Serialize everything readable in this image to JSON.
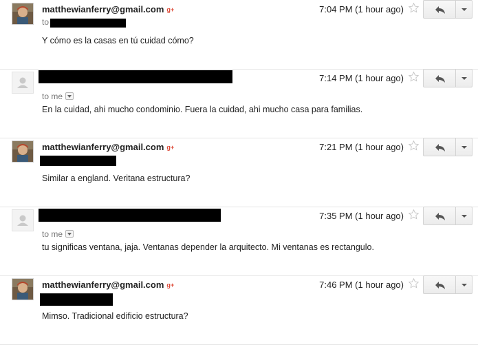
{
  "messages": [
    {
      "sender": "matthewianferry@gmail.com",
      "avatar": "profile-photo",
      "recipient_prefix": "to",
      "time": "7:04 PM (1 hour ago)",
      "body": "Y cómo es la casas en tú cuidad cómo?"
    },
    {
      "sender": "",
      "avatar": "default-person-icon",
      "recipient_prefix": "to me",
      "time": "7:14 PM (1 hour ago)",
      "body": "En la cuidad, ahi mucho condominio. Fuera la cuidad, ahi mucho casa para familias."
    },
    {
      "sender": "matthewianferry@gmail.com",
      "avatar": "profile-photo",
      "recipient_prefix": "",
      "time": "7:21 PM (1 hour ago)",
      "body": "Similar a england. Veritana estructura?"
    },
    {
      "sender": "",
      "avatar": "default-person-icon",
      "recipient_prefix": "to me",
      "time": "7:35 PM (1 hour ago)",
      "body": "tu significas ventana, jaja. Ventanas depender la arquitecto. Mi ventanas es rectangulo."
    },
    {
      "sender": "matthewianferry@gmail.com",
      "avatar": "profile-photo",
      "recipient_prefix": "",
      "time": "7:46 PM (1 hour ago)",
      "body": "Mimso. Tradicional edificio estructura?"
    }
  ],
  "icons": {
    "gplus": "g+",
    "star": "star-icon",
    "reply": "reply-icon",
    "more": "chevron-down-icon"
  },
  "colors": {
    "gplus": "#dd4b39",
    "redaction": "#000000",
    "divider": "#e5e5e5"
  }
}
